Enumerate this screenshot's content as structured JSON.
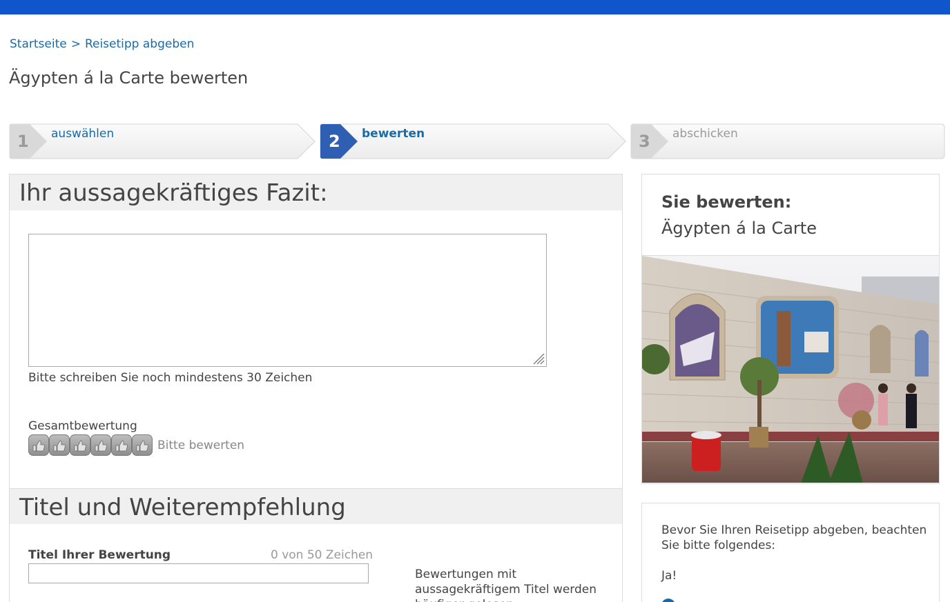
{
  "breadcrumb": {
    "home": "Startseite",
    "separator": ">",
    "current": "Reisetipp abgeben"
  },
  "page_title": "Ägypten á la Carte bewerten",
  "steps": [
    {
      "number": "1",
      "label": "auswählen",
      "state": "done"
    },
    {
      "number": "2",
      "label": "bewerten",
      "state": "active"
    },
    {
      "number": "3",
      "label": "abschicken",
      "state": "upcoming"
    }
  ],
  "fazit": {
    "heading": "Ihr aussagekräftiges Fazit:",
    "value": "",
    "hint": "Bitte schreiben Sie noch mindestens 30 Zeichen"
  },
  "rating": {
    "label": "Gesamtbewertung",
    "thumb_count": 6,
    "value": 0,
    "prompt": "Bitte bewerten"
  },
  "title_section": {
    "heading": "Titel und Weiterempfehlung",
    "label": "Titel Ihrer Bewertung",
    "char_count": "0 von 50 Zeichen",
    "value": "",
    "note": "Bewertungen mit aussagekräftigem Titel werden häufiger gelesen"
  },
  "sidebar": {
    "rating_heading": "Sie bewerten:",
    "rating_item": "Ägypten á la Carte",
    "notice_text": "Bevor Sie Ihren Reisetipp abgeben, beachten Sie bitte folgendes:",
    "notice_yes": "Ja!"
  },
  "colors": {
    "topbar": "#1155cc",
    "link": "#1a6aa8",
    "active_step": "#2f5fb3",
    "section_header_bg": "#f0f0f0"
  }
}
